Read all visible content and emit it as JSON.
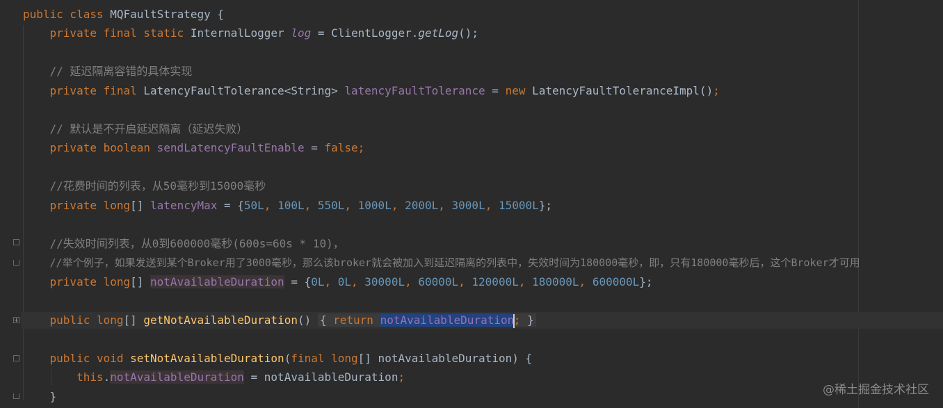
{
  "editor": {
    "lines": {
      "l1": {
        "kw1": "public class ",
        "name": "MQFaultStrategy",
        "brace": " {"
      },
      "l2": {
        "kw": "private final static ",
        "type": "InternalLogger ",
        "field": "log",
        "eq": " = ClientLogger.",
        "method": "getLog",
        "tail": "();"
      },
      "l4": {
        "comment": "// 延迟隔离容错的具体实现"
      },
      "l5": {
        "kw": "private final ",
        "type": "LatencyFaultTolerance<String> ",
        "field": "latencyFaultTolerance",
        "eq": " = ",
        "kw2": "new ",
        "ctor": "LatencyFaultToleranceImpl()",
        "semi": ";"
      },
      "l7": {
        "comment": "// 默认是不开启延迟隔离（延迟失败）"
      },
      "l8": {
        "kw": "private boolean ",
        "field": "sendLatencyFaultEnable",
        "eq": " = ",
        "val": "false",
        "semi": ";"
      },
      "l10": {
        "comment": "//花费时间的列表，从50毫秒到15000毫秒"
      },
      "l11": {
        "kw": "private ",
        "type": "long",
        "arr": "[] ",
        "field": "latencyMax",
        "eq": " = {",
        "values": [
          "50L",
          "100L",
          "550L",
          "1000L",
          "2000L",
          "3000L",
          "15000L"
        ],
        "end": "};"
      },
      "l13": {
        "comment": "//失效时间列表，从0到600000毫秒(600s=60s * 10)，"
      },
      "l14": {
        "comment": "//举个例子，如果发送到某个Broker用了3000毫秒，那么该broker就会被加入到延迟隔离的列表中，失效时间为180000毫秒，即，只有180000毫秒后，这个Broker才可用"
      },
      "l15": {
        "kw": "private ",
        "type": "long",
        "arr": "[] ",
        "field": "notAvailableDuration",
        "eq": " = {",
        "values": [
          "0L",
          "0L",
          "30000L",
          "60000L",
          "120000L",
          "180000L",
          "600000L"
        ],
        "end": "};"
      },
      "l17": {
        "kw": "public ",
        "type": "long",
        "arr": "[] ",
        "method": "getNotAvailableDuration",
        "parens": "() ",
        "open": "{ ",
        "ret": "return ",
        "field": "notAvailableDuration",
        "semi": ";",
        "close": " }"
      },
      "l19": {
        "kw": "public void ",
        "method": "setNotAvailableDuration",
        "paren": "(",
        "kw2": "final ",
        "type": "long",
        "param": "[] notAvailableDuration) {"
      },
      "l20": {
        "kw": "this",
        "dot": ".",
        "field": "notAvailableDuration",
        "eq": " = notAvailableDuration",
        "semi": ";"
      },
      "l21": {
        "brace": "}"
      }
    }
  },
  "watermark": "@稀土掘金技术社区",
  "colors": {
    "background": "#2b2b2b",
    "keyword": "#cc7832",
    "field": "#9876aa",
    "number": "#6897bb",
    "comment": "#808080",
    "method": "#ffc66d",
    "selection": "#214283"
  }
}
